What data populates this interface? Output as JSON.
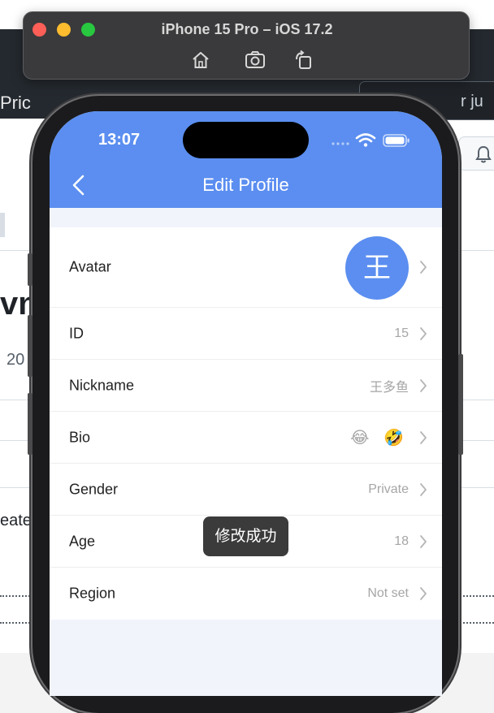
{
  "background": {
    "nav_left_text": "Pric",
    "nav_search_text": "r ju",
    "big_text": "vn",
    "mid_text": "20",
    "left_text": "eates"
  },
  "simulator": {
    "title": "iPhone 15 Pro – iOS 17.2",
    "tools": [
      "home-icon",
      "screenshot-icon",
      "rotate-icon"
    ]
  },
  "status_bar": {
    "time": "13:07"
  },
  "header": {
    "title": "Edit Profile"
  },
  "rows": [
    {
      "label": "Avatar",
      "avatar_text": "王"
    },
    {
      "label": "ID",
      "value": "15"
    },
    {
      "label": "Nickname",
      "value": "王多鱼"
    },
    {
      "label": "Bio",
      "value": "😂 🤣"
    },
    {
      "label": "Gender",
      "value": "Private"
    },
    {
      "label": "Age",
      "value": "18"
    },
    {
      "label": "Region",
      "value": "Not set"
    }
  ],
  "toast": {
    "text": "修改成功"
  },
  "colors": {
    "accent": "#5b8ef0",
    "screen_bg": "#f1f4fb",
    "value_grey": "#a6a6a6"
  }
}
